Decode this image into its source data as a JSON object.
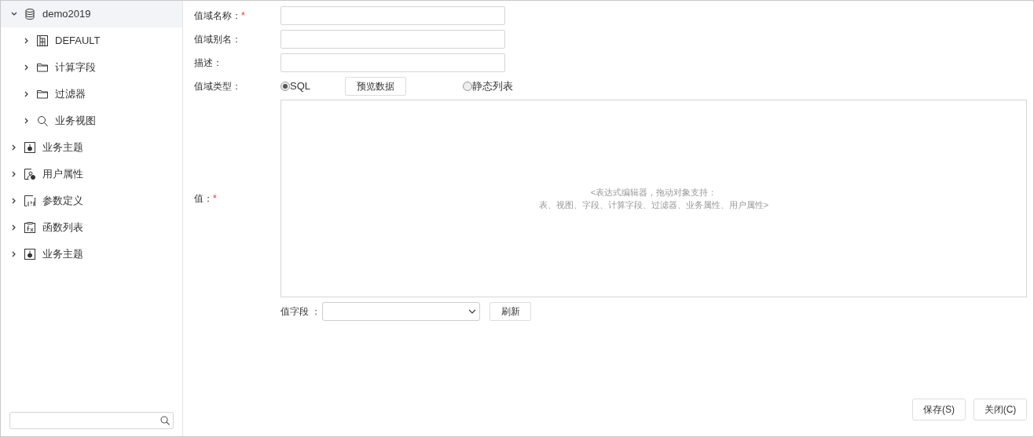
{
  "tree": [
    {
      "label": "demo2019",
      "kind": "database",
      "expanded": true,
      "selected": true,
      "children": [
        {
          "label": "DEFAULT",
          "kind": "table",
          "expanded": false,
          "selected": false
        },
        {
          "label": "计算字段",
          "kind": "folder",
          "expanded": false,
          "selected": false
        },
        {
          "label": "过滤器",
          "kind": "folder",
          "expanded": false,
          "selected": false
        },
        {
          "label": "业务视图",
          "kind": "search",
          "expanded": false,
          "selected": false
        }
      ]
    },
    {
      "label": "业务主题",
      "kind": "subject",
      "expanded": false,
      "selected": false
    },
    {
      "label": "用户属性",
      "kind": "user",
      "expanded": false,
      "selected": false
    },
    {
      "label": "参数定义",
      "kind": "param",
      "expanded": false,
      "selected": false
    },
    {
      "label": "函数列表",
      "kind": "function",
      "expanded": false,
      "selected": false
    },
    {
      "label": "业务主题",
      "kind": "subject",
      "expanded": false,
      "selected": false
    }
  ],
  "fields": [
    {
      "label": "值域名称：",
      "required_mark": "*"
    },
    {
      "label": "值域别名："
    },
    {
      "label": "描述："
    }
  ],
  "type_label": "值域类型：",
  "type_options": [
    {
      "label": "SQL",
      "selected": true
    },
    {
      "label": "静态列表",
      "selected": false
    }
  ],
  "preview_button": "预览数据",
  "value_label": "值：",
  "value_required_mark": "*",
  "editor_placeholder": [
    "<表达式编辑器，拖动对象支持：",
    "表、视图、字段、计算字段、过滤器、业务属性、用户属性>"
  ],
  "value_field_label": "值字段 ：",
  "refresh_button": "刷新",
  "footer_buttons": [
    "保存(S)",
    "关闭(C)"
  ]
}
